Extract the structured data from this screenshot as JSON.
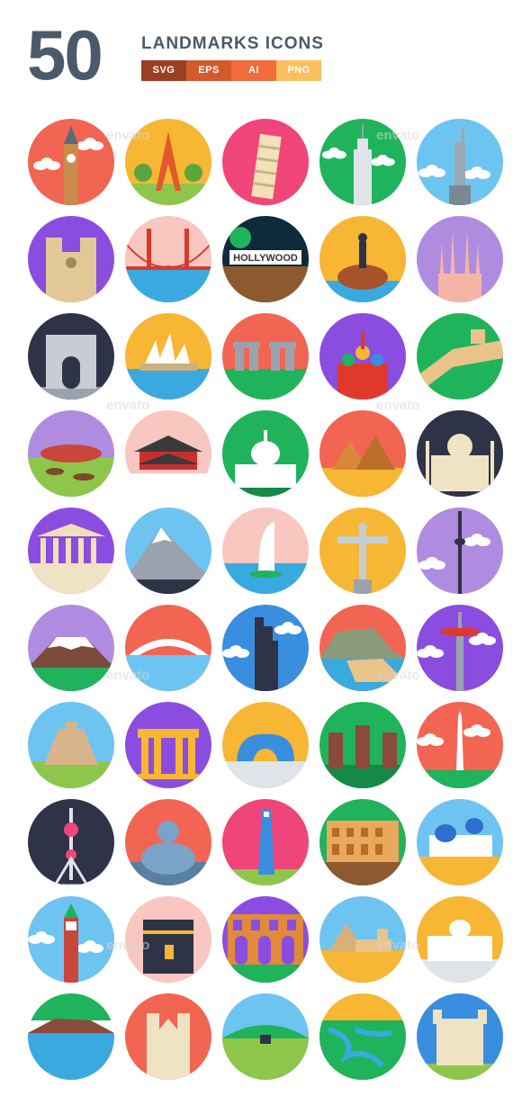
{
  "header": {
    "count": "50",
    "title": "LANDMARKS ICONS",
    "formats": [
      {
        "label": "SVG",
        "color": "#9b3f22"
      },
      {
        "label": "EPS",
        "color": "#d45a2c"
      },
      {
        "label": "AI",
        "color": "#f26b3a"
      },
      {
        "label": "PNG",
        "color": "#fbbf5e"
      }
    ]
  },
  "watermark": "envato",
  "icons": [
    {
      "name": "big-ben-icon",
      "bg": "#f26552",
      "scene": "tower",
      "ground": "#f26552",
      "accent": "#c98a4a"
    },
    {
      "name": "eiffel-tower-icon",
      "bg": "#f7b633",
      "scene": "eiffel",
      "ground": "#8ec64b",
      "accent": "#e05a2b"
    },
    {
      "name": "leaning-tower-icon",
      "bg": "#f0457a",
      "scene": "pisa",
      "ground": "#f0457a",
      "accent": "#f1e0b8"
    },
    {
      "name": "empire-state-icon",
      "bg": "#1fb35c",
      "scene": "skyscraper",
      "ground": "#1fb35c",
      "accent": "#dfe4ea"
    },
    {
      "name": "statue-of-liberty-icon",
      "bg": "#6ec4f0",
      "scene": "statue",
      "ground": "#6ec4f0",
      "accent": "#9aa8b2"
    },
    {
      "name": "notre-dame-icon",
      "bg": "#8b4de0",
      "scene": "cathedral",
      "ground": "#8b4de0",
      "accent": "#e2c897"
    },
    {
      "name": "golden-gate-icon",
      "bg": "#f9c6c0",
      "scene": "bridge",
      "ground": "#3aa9e0",
      "accent": "#d93a2b"
    },
    {
      "name": "hollywood-sign-icon",
      "bg": "#0f2a3a",
      "scene": "hollywood",
      "ground": "#8c5a2e",
      "accent": "#ffffff"
    },
    {
      "name": "little-mermaid-icon",
      "bg": "#f7b633",
      "scene": "mermaid",
      "ground": "#3aa9e0",
      "accent": "#a8522a"
    },
    {
      "name": "sagrada-familia-icon",
      "bg": "#b08ce0",
      "scene": "sagrada",
      "ground": "#b08ce0",
      "accent": "#f5b5a6"
    },
    {
      "name": "arc-de-triomphe-icon",
      "bg": "#2f3347",
      "scene": "arch",
      "ground": "#9aa3ad",
      "accent": "#c8cdd3"
    },
    {
      "name": "sydney-opera-icon",
      "bg": "#f7b633",
      "scene": "opera",
      "ground": "#3aa9e0",
      "accent": "#ffffff"
    },
    {
      "name": "stonehenge-icon",
      "bg": "#f26552",
      "scene": "stonehenge",
      "ground": "#1fb35c",
      "accent": "#9aa3ad"
    },
    {
      "name": "st-basils-icon",
      "bg": "#8b4de0",
      "scene": "basils",
      "ground": "#8b4de0",
      "accent": "#e0392b"
    },
    {
      "name": "great-wall-icon",
      "bg": "#1fb35c",
      "scene": "wall",
      "ground": "#1fb35c",
      "accent": "#e9c38a"
    },
    {
      "name": "uluru-icon",
      "bg": "#b08ce0",
      "scene": "uluru",
      "ground": "#8ec64b",
      "accent": "#c8463a"
    },
    {
      "name": "forbidden-city-icon",
      "bg": "#f9c6c0",
      "scene": "pagoda",
      "ground": "#ffffff",
      "accent": "#c8302b"
    },
    {
      "name": "capitol-icon",
      "bg": "#1fb35c",
      "scene": "capitol",
      "ground": "#1fb35c",
      "accent": "#ffffff"
    },
    {
      "name": "pyramids-icon",
      "bg": "#f26552",
      "scene": "pyramids",
      "ground": "#f7b633",
      "accent": "#d9883a"
    },
    {
      "name": "taj-mahal-icon",
      "bg": "#2f3347",
      "scene": "taj",
      "ground": "#2f3347",
      "accent": "#efe3c3"
    },
    {
      "name": "parthenon-icon",
      "bg": "#8b4de0",
      "scene": "parthenon",
      "ground": "#efe3c3",
      "accent": "#f1e0b8"
    },
    {
      "name": "matterhorn-icon",
      "bg": "#6ec4f0",
      "scene": "mountain",
      "ground": "#2f3347",
      "accent": "#ffffff"
    },
    {
      "name": "burj-al-arab-icon",
      "bg": "#f9c6c0",
      "scene": "burj",
      "ground": "#3aa9e0",
      "accent": "#ffffff"
    },
    {
      "name": "christ-redeemer-icon",
      "bg": "#f7b633",
      "scene": "christ",
      "ground": "#f7b633",
      "accent": "#c8cdd3"
    },
    {
      "name": "cn-tower-icon",
      "bg": "#b08ce0",
      "scene": "needle",
      "ground": "#b08ce0",
      "accent": "#2f3347"
    },
    {
      "name": "mount-fuji-icon",
      "bg": "#b08ce0",
      "scene": "fuji",
      "ground": "#1fb35c",
      "accent": "#ffffff"
    },
    {
      "name": "rialto-bridge-icon",
      "bg": "#f26552",
      "scene": "rialto",
      "ground": "#6ec4f0",
      "accent": "#ffffff"
    },
    {
      "name": "willis-tower-icon",
      "bg": "#3a8ee0",
      "scene": "willis",
      "ground": "#3a8ee0",
      "accent": "#2f3347"
    },
    {
      "name": "cliffs-icon",
      "bg": "#f26552",
      "scene": "cliff",
      "ground": "#3aa9e0",
      "accent": "#e9c38a"
    },
    {
      "name": "space-needle-icon",
      "bg": "#8b4de0",
      "scene": "spaceneedle",
      "ground": "#8b4de0",
      "accent": "#e0392b"
    },
    {
      "name": "chichen-itza-icon",
      "bg": "#6ec4f0",
      "scene": "maya",
      "ground": "#8ec64b",
      "accent": "#d7b48a"
    },
    {
      "name": "brandenburg-gate-icon",
      "bg": "#8b4de0",
      "scene": "gate",
      "ground": "#8b4de0",
      "accent": "#f7b633"
    },
    {
      "name": "cloud-gate-icon",
      "bg": "#f7b633",
      "scene": "bean",
      "ground": "#dfe4ea",
      "accent": "#3a8ee0"
    },
    {
      "name": "moai-icon",
      "bg": "#1fb35c",
      "scene": "moai",
      "ground": "#1fb35c",
      "accent": "#8c4a3a"
    },
    {
      "name": "washington-monument-icon",
      "bg": "#f26552",
      "scene": "obelisk",
      "ground": "#1fb35c",
      "accent": "#ffffff"
    },
    {
      "name": "oriental-pearl-icon",
      "bg": "#2f3347",
      "scene": "pearl",
      "ground": "#2f3347",
      "accent": "#f0457a"
    },
    {
      "name": "great-buddha-icon",
      "bg": "#f26552",
      "scene": "buddha",
      "ground": "#5a7fa0",
      "accent": "#7aa3c8"
    },
    {
      "name": "shanghai-tower-icon",
      "bg": "#f0457a",
      "scene": "shanghai",
      "ground": "#8ec64b",
      "accent": "#3a8ee0"
    },
    {
      "name": "colosseum-icon",
      "bg": "#1fb35c",
      "scene": "colosseum",
      "ground": "#8c5a2e",
      "accent": "#e9a85a"
    },
    {
      "name": "santorini-icon",
      "bg": "#6ec4f0",
      "scene": "santorini",
      "ground": "#f7b633",
      "accent": "#2f6fd0"
    },
    {
      "name": "campanile-icon",
      "bg": "#6ec4f0",
      "scene": "campanile",
      "ground": "#6ec4f0",
      "accent": "#c8463a"
    },
    {
      "name": "kaaba-icon",
      "bg": "#f9c6c0",
      "scene": "kaaba",
      "ground": "#f9c6c0",
      "accent": "#2f3347"
    },
    {
      "name": "pont-du-gard-icon",
      "bg": "#8b4de0",
      "scene": "aqueduct",
      "ground": "#1fb35c",
      "accent": "#e08a3a"
    },
    {
      "name": "sphinx-icon",
      "bg": "#6ec4f0",
      "scene": "sphinx",
      "ground": "#f7b633",
      "accent": "#e9c38a"
    },
    {
      "name": "st-peters-icon",
      "bg": "#f7b633",
      "scene": "basilica",
      "ground": "#dfe4ea",
      "accent": "#ffffff"
    },
    {
      "name": "island-icon",
      "bg": "#ffffff",
      "scene": "island",
      "ground": "#3aa9e0",
      "accent": "#8c4a3a"
    },
    {
      "name": "westminster-abbey-icon",
      "bg": "#f26552",
      "scene": "abbey",
      "ground": "#f26552",
      "accent": "#efe3c3"
    },
    {
      "name": "bird-nest-icon",
      "bg": "#6ec4f0",
      "scene": "dome",
      "ground": "#8ec64b",
      "accent": "#1fb35c"
    },
    {
      "name": "river-delta-icon",
      "bg": "#f7b633",
      "scene": "delta",
      "ground": "#1fb35c",
      "accent": "#3aa9e0"
    },
    {
      "name": "tower-of-london-icon",
      "bg": "#3a8ee0",
      "scene": "fortress",
      "ground": "#8ec64b",
      "accent": "#efe3c3"
    }
  ]
}
